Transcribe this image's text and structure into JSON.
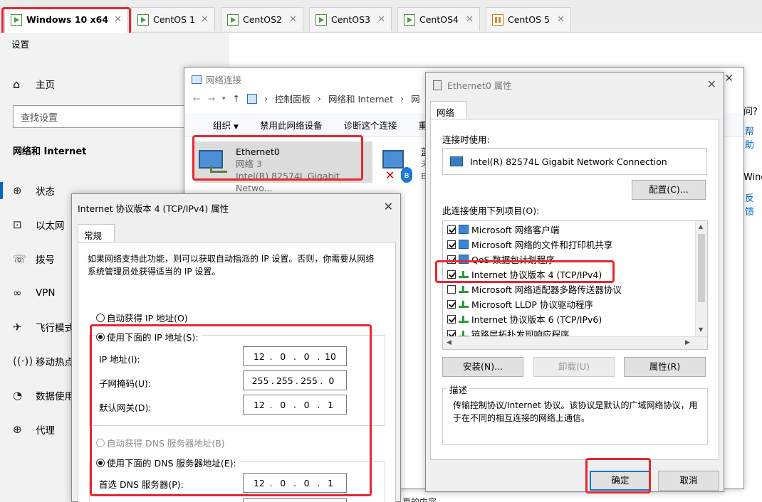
{
  "vm_tabs": [
    {
      "label": "Windows 10 x64",
      "active": true
    },
    {
      "label": "CentOS 1"
    },
    {
      "label": "CentOS2"
    },
    {
      "label": "CentOS3"
    },
    {
      "label": "CentOS4"
    },
    {
      "label": "CentOS 5",
      "suspended": true
    }
  ],
  "close_glyph": "✕",
  "settings": {
    "title": "设置",
    "home": "主页",
    "search_placeholder": "查找设置",
    "section": "网络和 Internet",
    "nav": [
      "状态",
      "以太网",
      "拨号",
      "VPN",
      "飞行模式",
      "移动热点",
      "数据使用",
      "代理"
    ]
  },
  "behind_text": {
    "q": "问?",
    "help": "帮助",
    "win": "Windo",
    "feedback": "反馈"
  },
  "network_window": {
    "title": "网络连接",
    "address": [
      "控制面板",
      "网络和 Internet",
      "网"
    ],
    "toolbar": [
      "组织",
      "禁用此网络设备",
      "诊断这个连接",
      "重命名"
    ],
    "adapters": [
      {
        "name": "Ethernet0",
        "network": "网络 3",
        "device": "Intel(R) 82574L Gigabit Netwo..."
      },
      {
        "name": "蓝",
        "network": "未",
        "device": "Bl"
      }
    ],
    "footer_text": "夏的内容"
  },
  "eth_props": {
    "title": "Ethernet0 属性",
    "tab": "网络",
    "connect_using_label": "连接时使用:",
    "device": "Intel(R) 82574L Gigabit Network Connection",
    "configure_btn": "配置(C)...",
    "items_label": "此连接使用下列项目(O):",
    "items": [
      {
        "label": "Microsoft 网络客户端",
        "checked": true,
        "icon": "client"
      },
      {
        "label": "Microsoft 网络的文件和打印机共享",
        "checked": true,
        "icon": "client"
      },
      {
        "label": "QoS 数据包计划程序",
        "checked": true,
        "icon": "client"
      },
      {
        "label": "Internet 协议版本 4 (TCP/IPv4)",
        "checked": true,
        "icon": "proto"
      },
      {
        "label": "Microsoft 网络适配器多路传送器协议",
        "checked": false,
        "icon": "proto"
      },
      {
        "label": "Microsoft LLDP 协议驱动程序",
        "checked": true,
        "icon": "proto"
      },
      {
        "label": "Internet 协议版本 6 (TCP/IPv6)",
        "checked": true,
        "icon": "proto"
      },
      {
        "label": "链路层拓扑发现响应程序",
        "checked": true,
        "icon": "proto"
      }
    ],
    "install_btn": "安装(N)...",
    "uninstall_btn": "卸载(U)",
    "properties_btn": "属性(R)",
    "desc_label": "描述",
    "desc_text": "传输控制协议/Internet 协议。该协议是默认的广域网络协议，用于在不同的相互连接的网络上通信。",
    "ok_btn": "确定",
    "cancel_btn": "取消"
  },
  "ipv4": {
    "title": "Internet 协议版本 4 (TCP/IPv4) 属性",
    "tab": "常规",
    "intro": "如果网络支持此功能，则可以获取自动指派的 IP 设置。否则，你需要从网络系统管理员处获得适当的 IP 设置。",
    "auto_ip": "自动获得 IP 地址(O)",
    "use_ip": "使用下面的 IP 地址(S):",
    "ip_label": "IP 地址(I):",
    "ip": [
      "12",
      "0",
      "0",
      "10"
    ],
    "mask_label": "子网掩码(U):",
    "mask": [
      "255",
      "255",
      "255",
      "0"
    ],
    "gw_label": "默认网关(D):",
    "gw": [
      "12",
      "0",
      "0",
      "1"
    ],
    "auto_dns": "自动获得 DNS 服务器地址(B)",
    "use_dns": "使用下面的 DNS 服务器地址(E):",
    "dns1_label": "首选 DNS 服务器(P):",
    "dns1": [
      "12",
      "0",
      "0",
      "1"
    ]
  },
  "colors": {
    "highlight": "#e8262f",
    "accent": "#0067c0"
  }
}
